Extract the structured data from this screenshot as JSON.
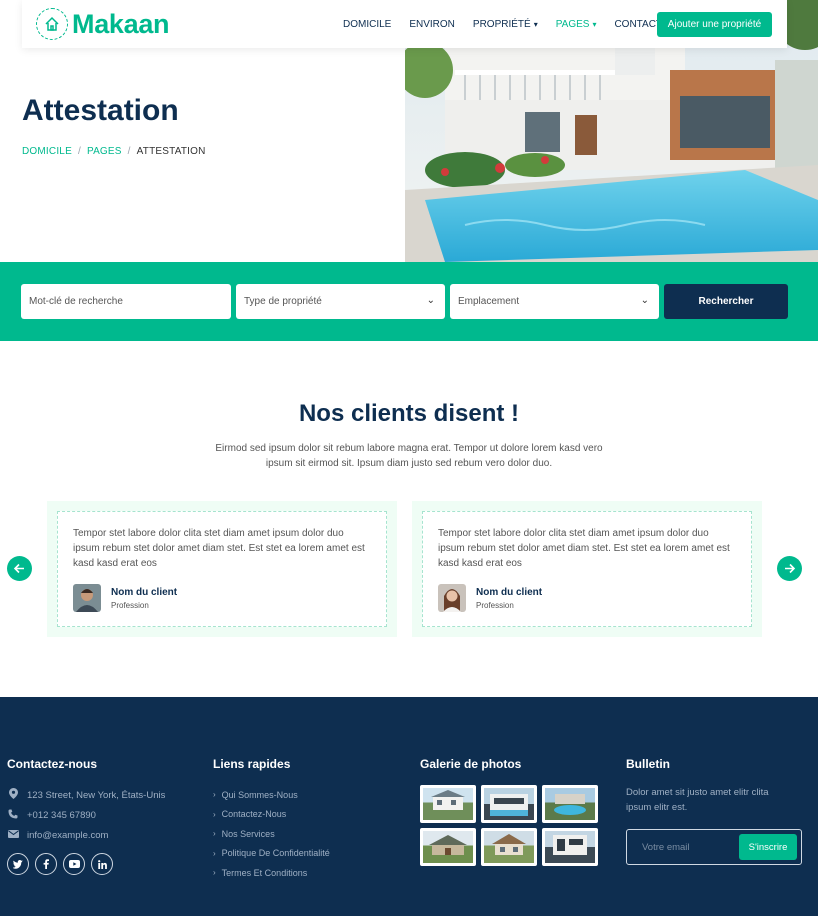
{
  "brand": {
    "logo_text": "Makaan",
    "accent": "#00b98e",
    "navy": "#0e2e50"
  },
  "nav": {
    "links": [
      {
        "label": "DOMICILE"
      },
      {
        "label": "ENVIRON"
      },
      {
        "label": "PROPRIÉTÉ"
      },
      {
        "label": "PAGES"
      },
      {
        "label": "CONTACT"
      }
    ],
    "cta": "Ajouter une propriété"
  },
  "hero": {
    "title": "Attestation",
    "breadcrumb": [
      "DOMICILE",
      "PAGES",
      "ATTESTATION"
    ]
  },
  "search": {
    "keyword_placeholder": "Mot-clé de recherche",
    "type_selected": "Type de propriété",
    "location_selected": "Emplacement",
    "button": "Rechercher"
  },
  "testimonials": {
    "title": "Nos clients disent !",
    "subtitle": "Eirmod sed ipsum dolor sit rebum labore magna erat. Tempor ut dolore lorem kasd vero ipsum sit eirmod sit. Ipsum diam justo sed rebum vero dolor duo.",
    "items": [
      {
        "text": "Tempor stet labore dolor clita stet diam amet ipsum dolor duo ipsum rebum stet dolor amet diam stet. Est stet ea lorem amet est kasd kasd erat eos",
        "name": "Nom du client",
        "profession": "Profession"
      },
      {
        "text": "Tempor stet labore dolor clita stet diam amet ipsum dolor duo ipsum rebum stet dolor amet diam stet. Est stet ea lorem amet est kasd kasd erat eos",
        "name": "Nom du client",
        "profession": "Profession"
      }
    ]
  },
  "footer": {
    "contact": {
      "heading": "Contactez-nous",
      "address": "123 Street, New York, États-Unis",
      "phone": "+012 345 67890",
      "email": "info@example.com",
      "socials": [
        "twitter-icon",
        "facebook-icon",
        "youtube-icon",
        "linkedin-icon"
      ]
    },
    "links": {
      "heading": "Liens rapides",
      "items": [
        "Qui Sommes-Nous",
        "Contactez-Nous",
        "Nos Services",
        "Politique De Confidentialité",
        "Termes Et Conditions"
      ]
    },
    "gallery": {
      "heading": "Galerie de photos"
    },
    "bulletin": {
      "heading": "Bulletin",
      "text": "Dolor amet sit justo amet elitr clita ipsum elitr est.",
      "placeholder": "Votre email",
      "button": "S'inscrire"
    }
  }
}
